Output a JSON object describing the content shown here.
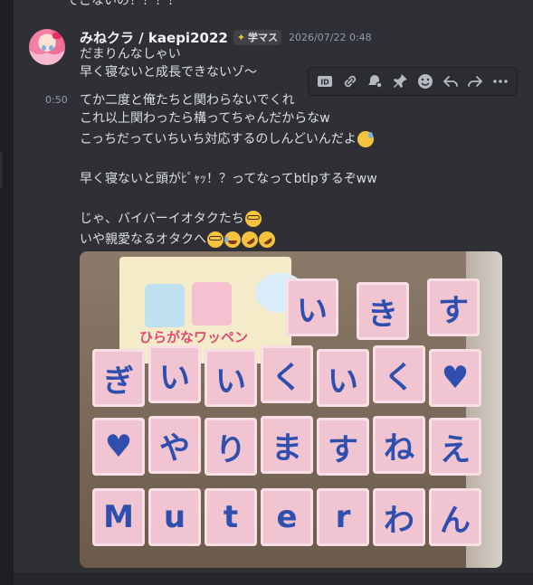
{
  "previous_message": {
    "text": "てこないの！！！！"
  },
  "message": {
    "username": "みねクラ / kaepi2022",
    "tag": {
      "icon": "gem-icon",
      "label": "学マス"
    },
    "timestamp": "2026/07/22 0:48",
    "hover_time": "0:50",
    "lines": [
      "だまりんなしゃい",
      "早く寝ないと成長できないゾ～",
      "てか二度と俺たちと関わらないでくれ",
      "これ以上関わったら構ってちゃんだからなw",
      "こっちだっていちいち対応するのしんどいんだよ",
      "",
      "早く寝ないと頭がﾋﾟｬｯ！？ってなってbtlpするぞww",
      "",
      "じゃ、バイバーイオタクたち",
      "いや親愛なるオタクへ"
    ],
    "emojis": {
      "line5": [
        "sweat-smile-emoji"
      ],
      "line9": [
        "nerd-face-emoji"
      ],
      "line10": [
        "nerd-face-emoji",
        "laughing-crying-emoji",
        "rofl-emoji",
        "rofl-emoji"
      ]
    }
  },
  "toolbar": {
    "buttons": [
      "id-icon",
      "link-icon",
      "mark-unread-icon",
      "pin-icon",
      "add-reaction-icon",
      "reply-icon",
      "forward-icon",
      "more-icon"
    ],
    "id_label": "ID"
  },
  "attachment": {
    "sign_title": "ひらがなワッペン",
    "tile_rows": [
      [
        "い",
        "き",
        "す"
      ],
      [
        "ぎ",
        "い",
        "い",
        "く",
        "い",
        "く",
        "♥"
      ],
      [
        "♥",
        "や",
        "り",
        "ま",
        "す",
        "ね",
        "え"
      ],
      [
        "M",
        "u",
        "t",
        "e",
        "r",
        "わ",
        "ん"
      ]
    ]
  }
}
